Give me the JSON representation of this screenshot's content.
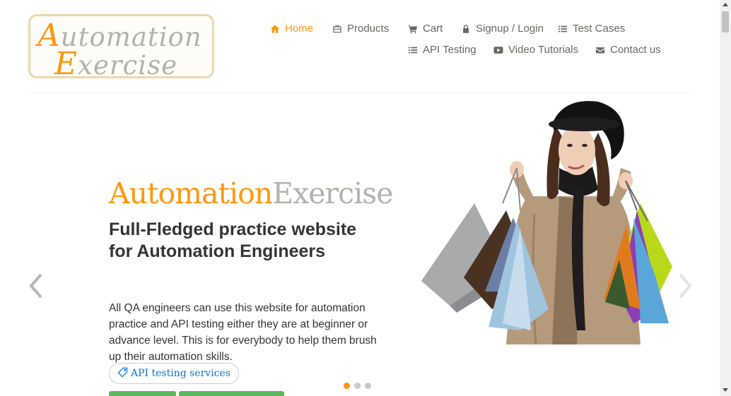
{
  "logo": {
    "line1_cap": "A",
    "line1_rest": "utomation",
    "line2_cap": "E",
    "line2_rest": "xercise"
  },
  "nav": {
    "items": [
      {
        "label": "Home",
        "icon": "home-icon",
        "active": true
      },
      {
        "label": "Products",
        "icon": "products-icon",
        "active": false
      },
      {
        "label": "Cart",
        "icon": "cart-icon",
        "active": false
      },
      {
        "label": "Signup / Login",
        "icon": "lock-icon",
        "active": false
      },
      {
        "label": "Test Cases",
        "icon": "list-icon",
        "active": false
      },
      {
        "label": "API Testing",
        "icon": "list-icon",
        "active": false
      },
      {
        "label": "Video Tutorials",
        "icon": "youtube-play-icon",
        "active": false
      },
      {
        "label": "Contact us",
        "icon": "envelope-icon",
        "active": false
      }
    ]
  },
  "slider": {
    "brand_part1": "Automation",
    "brand_part2": "Exercise",
    "headline": "Full-Fledged practice website for Automation Engineers",
    "description": "All QA engineers can use this website for automation practice and API testing either they are at beginner or advance level. This is for everybody to help them brush up their automation skills.",
    "pill_label": "API testing services",
    "active_slide": 1,
    "slide_count": 3
  },
  "colors": {
    "accent": "#fe980f",
    "muted": "#b4b1ab",
    "text": "#696763",
    "dark": "#363432",
    "link": "#0e75c7",
    "button": "#5cb85c"
  }
}
